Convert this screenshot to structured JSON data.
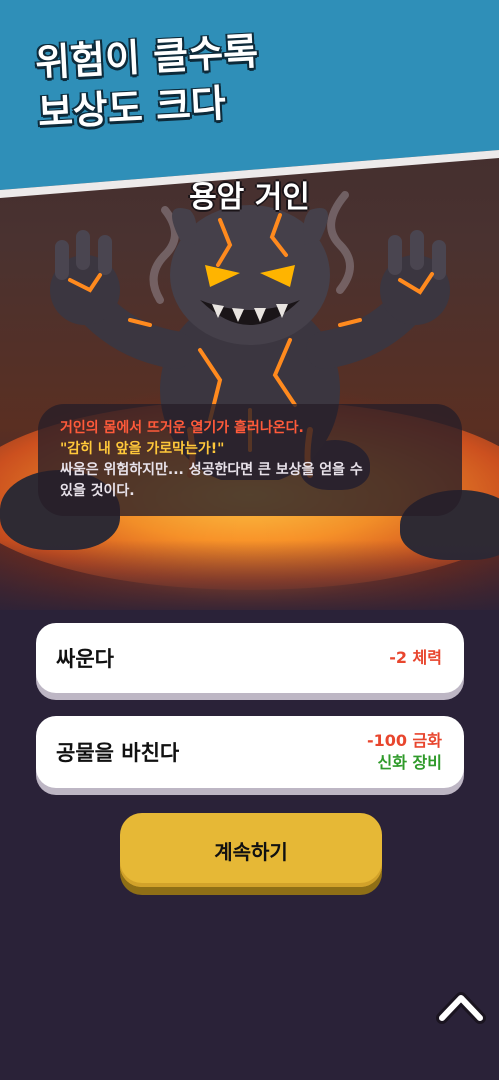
{
  "banner": {
    "line1": "위험이 클수록",
    "line2": "보상도 크다",
    "color": "#2f8fb8"
  },
  "encounter": {
    "title": "용암 거인",
    "narration": {
      "line1": "거인의 몸에서 뜨거운 열기가 흘러나온다.",
      "line2": "\"감히 내 앞을 가로막는가!\"",
      "line3": "싸움은 위험하지만... 성공한다면 큰 보상을 얻을 수",
      "line4": "있을 것이다."
    }
  },
  "choices": [
    {
      "label": "싸운다",
      "costs": [
        {
          "text": "-2 체력",
          "color": "#e8462e"
        }
      ]
    },
    {
      "label": "공물을 바친다",
      "costs": [
        {
          "text": "-100 금화",
          "color": "#e8462e"
        },
        {
          "text": "신화 장비",
          "color": "#2f9a2a"
        }
      ]
    }
  ],
  "continue_button": {
    "label": "계속하기",
    "color": "#e6b836"
  },
  "icons": {
    "scroll_up": "chevron-up-icon",
    "monster": "lava-giant-illustration"
  }
}
